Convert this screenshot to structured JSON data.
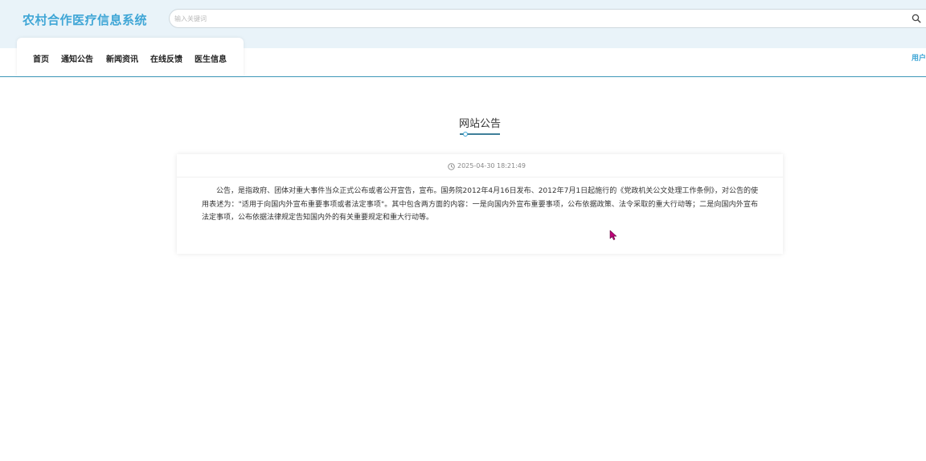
{
  "header": {
    "site_title": "农村合作医疗信息系统",
    "search": {
      "placeholder": "输入关键词",
      "value": ""
    },
    "user_label": "用户"
  },
  "nav": {
    "items": [
      {
        "label": "首页"
      },
      {
        "label": "通知公告"
      },
      {
        "label": "新闻资讯"
      },
      {
        "label": "在线反馈"
      },
      {
        "label": "医生信息"
      }
    ]
  },
  "main": {
    "section_title": "网站公告",
    "article": {
      "date": "2025-04-30 18:21:49",
      "body": "公告，是指政府、团体对重大事件当众正式公布或者公开宣告，宣布。国务院2012年4月16日发布、2012年7月1日起施行的《党政机关公文处理工作条例》，对公告的使用表述为：\"适用于向国内外宣布重要事项或者法定事项\"。其中包含两方面的内容：一是向国内外宣布重要事项，公布依据政策、法令采取的重大行动等；二是向国内外宣布法定事项，公布依据法律规定告知国内外的有关重要规定和重大行动等。"
    }
  },
  "colors": {
    "accent": "#3fa6d6",
    "header_bg": "#e9f3f9",
    "divider": "#3f97b8",
    "cursor": "#c0007a"
  },
  "icons": {
    "search": "search-icon",
    "clock": "clock-icon",
    "cursor": "mouse-cursor-icon"
  }
}
